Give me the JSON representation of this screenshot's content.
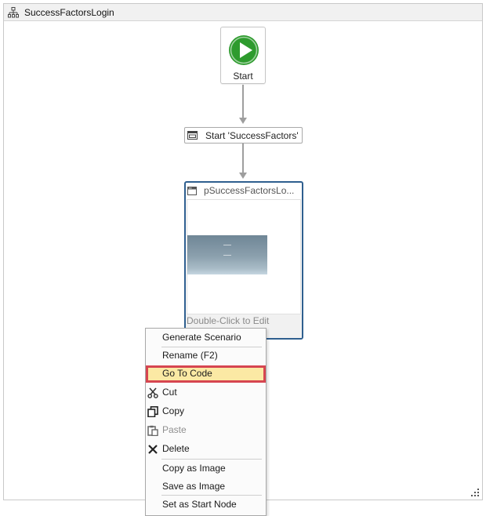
{
  "window": {
    "title": "SuccessFactorsLogin",
    "title_icon": "workflow-tree-icon"
  },
  "flow": {
    "start_node": {
      "label": "Start",
      "icon": "play-icon",
      "color": "#2e9b2e"
    },
    "action_node": {
      "label": "Start 'SuccessFactors'",
      "icon": "application-window-icon"
    },
    "page_node": {
      "label": "pSuccessFactorsLo...",
      "icon": "page-icon",
      "footer": "Double-Click to Edit",
      "border_color": "#2f5f8f"
    }
  },
  "context_menu": {
    "highlight_color": "#d64550",
    "items": [
      {
        "label": "Generate Scenario",
        "icon": null,
        "disabled": false
      },
      {
        "label": "Rename (F2)",
        "icon": null,
        "disabled": false
      },
      {
        "label": "Go To Code",
        "icon": null,
        "disabled": false,
        "highlighted": true
      },
      {
        "label": "Cut",
        "icon": "scissors-icon",
        "disabled": false
      },
      {
        "label": "Copy",
        "icon": "copy-icon",
        "disabled": false
      },
      {
        "label": "Paste",
        "icon": "paste-icon",
        "disabled": true
      },
      {
        "label": "Delete",
        "icon": "delete-x-icon",
        "disabled": false
      },
      {
        "label": "Copy as Image",
        "icon": null,
        "disabled": false
      },
      {
        "label": "Save as Image",
        "icon": null,
        "disabled": false
      },
      {
        "label": "Set as Start Node",
        "icon": null,
        "disabled": false
      }
    ]
  }
}
